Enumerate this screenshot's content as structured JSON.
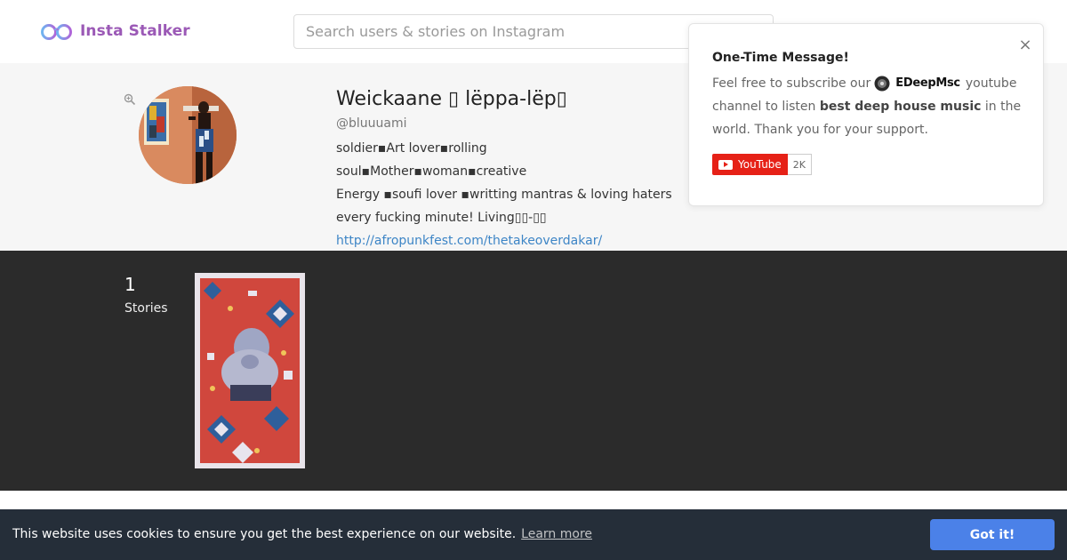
{
  "header": {
    "logo_text": "Insta Stalker",
    "search_placeholder": "Search users & stories on Instagram",
    "logo_icon": "glasses-icon",
    "brand_color": "#9b59b6"
  },
  "profile": {
    "display_name": "Weickaane ▯ lëppa-lëp▯",
    "username": "@bluuuami",
    "bio_lines": [
      "soldier▪Art lover▪rolling soul▪Mother▪woman▪creative",
      "Energy ▪soufi lover ▪writting mantras & loving haters",
      "every fucking minute! Living▯▯-▯▯"
    ],
    "link": "http://afropunkfest.com/thetakeoverdakar/",
    "link_color": "#3d85c6"
  },
  "stories": {
    "count": "1",
    "label": "Stories"
  },
  "popup": {
    "title": "One-Time Message!",
    "body_prefix": "Feel free to subscribe our",
    "channel_name": "EDeepMsc",
    "body_middle": "youtube channel to listen",
    "body_bold": "best deep house music",
    "body_suffix": "in the world. Thank you for your support.",
    "youtube_label": "YouTube",
    "youtube_count": "2K",
    "close_symbol": "×",
    "youtube_color": "#e62117"
  },
  "cookie": {
    "text": "This website uses cookies to ensure you get the best experience on our website.",
    "learn_more": "Learn more",
    "button": "Got it!",
    "button_color": "#4b81e8"
  }
}
